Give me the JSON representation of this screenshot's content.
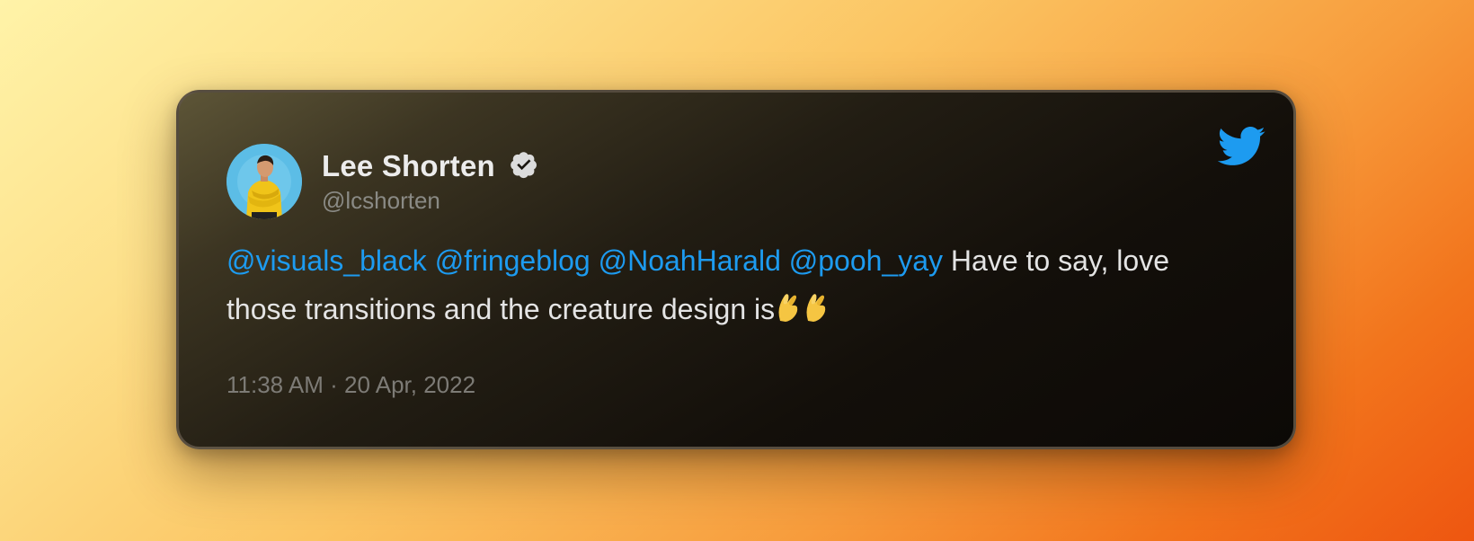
{
  "tweet": {
    "author": {
      "name": "Lee Shorten",
      "handle": "@lcshorten",
      "verified": true,
      "avatar_icon": "person-avatar"
    },
    "mentions": [
      "@visuals_black",
      "@fringeblog",
      "@NoahHarald",
      "@pooh_yay"
    ],
    "text_after_mentions": "Have to say, love those transitions and the creature design is",
    "emojis": [
      "pinched-fingers-emoji",
      "pinched-fingers-emoji"
    ],
    "timestamp": "11:38 AM · 20 Apr, 2022",
    "platform_icon": "twitter-bird-icon"
  },
  "colors": {
    "mention": "#1d9bf0",
    "twitter_blue": "#1d9bf0",
    "text": "#e4e4e4",
    "muted": "#7d7b76"
  }
}
